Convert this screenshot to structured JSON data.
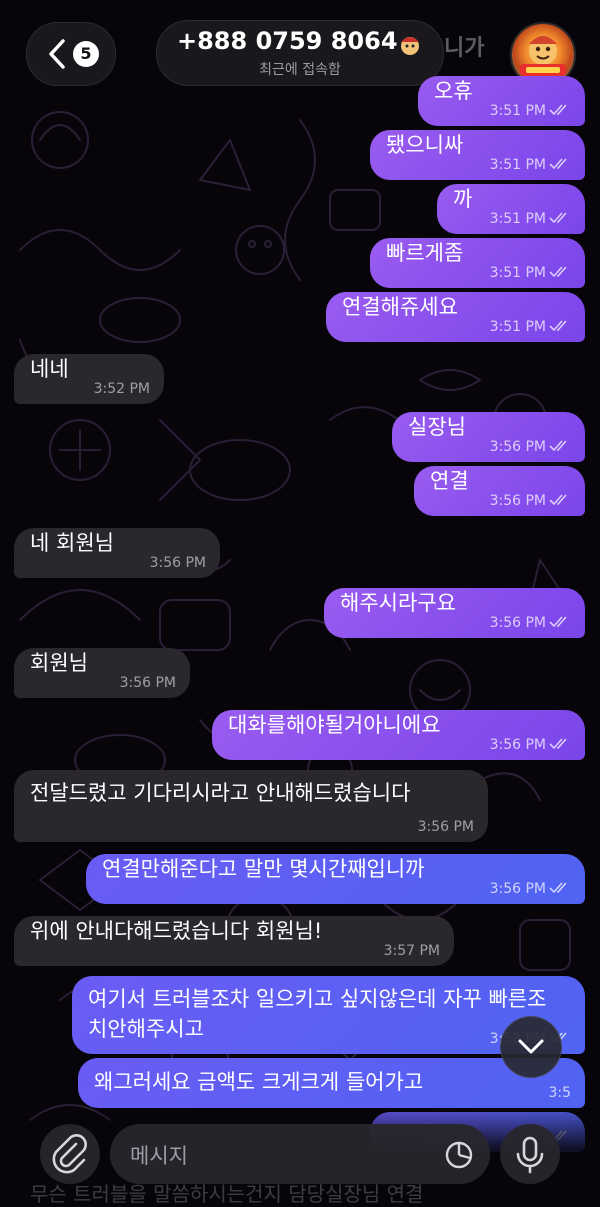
{
  "header": {
    "back_badge": "5",
    "contact_name": "+888 0759 8064",
    "status": "최근에 접속함",
    "peek_text": "니가"
  },
  "messages": [
    {
      "dir": "out",
      "text": "오휴",
      "time": "3:51 PM",
      "read": true
    },
    {
      "dir": "out",
      "text": "됐으니싸",
      "time": "3:51 PM",
      "read": true
    },
    {
      "dir": "out",
      "text": "까",
      "time": "3:51 PM",
      "read": true
    },
    {
      "dir": "out",
      "text": "빠르게좀",
      "time": "3:51 PM",
      "read": true
    },
    {
      "dir": "out",
      "text": "연결해쥬세요",
      "time": "3:51 PM",
      "read": true
    },
    {
      "dir": "in",
      "text": "네네",
      "time": "3:52 PM"
    },
    {
      "dir": "out",
      "text": "실장님",
      "time": "3:56 PM",
      "read": true
    },
    {
      "dir": "out",
      "text": "연결",
      "time": "3:56 PM",
      "read": true
    },
    {
      "dir": "in",
      "text": "네 회원님",
      "time": "3:56 PM"
    },
    {
      "dir": "out",
      "text": "해주시라구요",
      "time": "3:56 PM",
      "read": true
    },
    {
      "dir": "in",
      "text": "회원님",
      "time": "3:56 PM"
    },
    {
      "dir": "out",
      "text": "대화를해야될거아니에요",
      "time": "3:56 PM",
      "read": true
    },
    {
      "dir": "in",
      "text": "전달드렸고 기다리시라고 안내해드렸습니다",
      "time": "3:56 PM"
    },
    {
      "dir": "out",
      "text": "연결만해준다고 말만 몇시간째입니까",
      "time": "3:56 PM",
      "read": true
    },
    {
      "dir": "in",
      "text": "위에 안내다해드렸습니다 회원님!",
      "time": "3:57 PM"
    },
    {
      "dir": "out",
      "text": "여기서 트러블조차 일으키고 싶지않은데 자꾸 빠른조치안해주시고",
      "time": "3:58 PM",
      "read": true
    },
    {
      "dir": "out",
      "text": "왜그러세요 금액도 크게크게 들어가고",
      "time": "3:5",
      "read": false
    },
    {
      "dir": "out",
      "text": "",
      "time": "",
      "read": true
    }
  ],
  "composer": {
    "placeholder": "메시지",
    "peek_text": "무슨 트러블을 말씀하시는건지 담당실장님 연결"
  },
  "colors": {
    "outgoing": "#8a52ee",
    "outgoing_blue": "#5a60f4",
    "incoming": "#2a272d",
    "background": "#070509"
  },
  "icons": {
    "back": "chevron-left-icon",
    "attach": "paperclip-icon",
    "sticker": "sticker-icon",
    "mic": "microphone-icon",
    "scroll": "chevron-down-icon",
    "read": "double-check-icon"
  }
}
